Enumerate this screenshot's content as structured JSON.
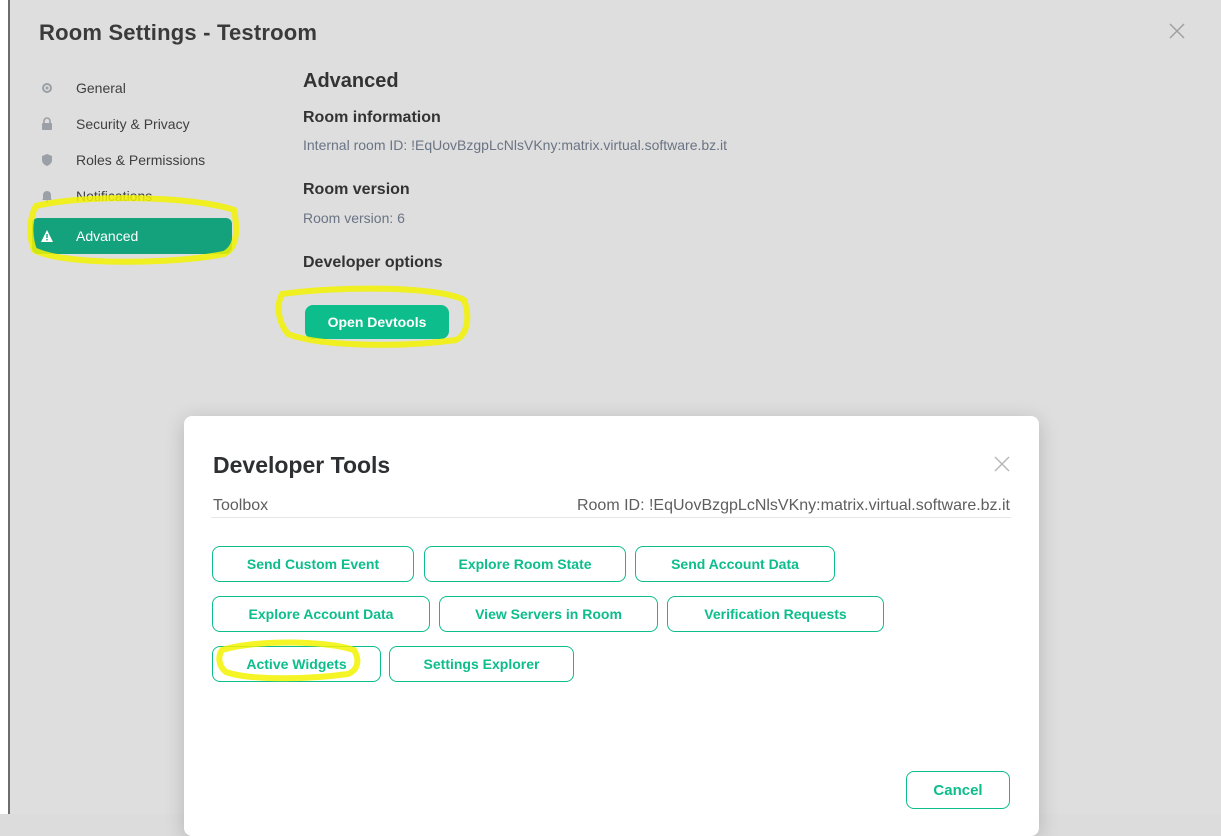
{
  "settings": {
    "title": "Room Settings - Testroom",
    "close_icon": "close-icon",
    "nav": [
      {
        "label": "General",
        "icon": "gear-icon"
      },
      {
        "label": "Security & Privacy",
        "icon": "lock-icon"
      },
      {
        "label": "Roles & Permissions",
        "icon": "shield-icon"
      },
      {
        "label": "Notifications",
        "icon": "bell-icon"
      },
      {
        "label": "Advanced",
        "icon": "warning-icon",
        "active": true
      }
    ]
  },
  "advanced": {
    "heading": "Advanced",
    "room_info_heading": "Room information",
    "internal_id": "Internal room ID: !EqUovBzgpLcNlsVKny:matrix.virtual.software.bz.it",
    "room_version_heading": "Room version",
    "room_version": "Room version: 6",
    "dev_options_heading": "Developer options",
    "open_devtools": "Open Devtools"
  },
  "devtools": {
    "title": "Developer Tools",
    "toolbox": "Toolbox",
    "room_id": "Room ID: !EqUovBzgpLcNlsVKny:matrix.virtual.software.bz.it",
    "buttons": [
      "Send Custom Event",
      "Explore Room State",
      "Send Account Data",
      "Explore Account Data",
      "View Servers in Room",
      "Verification Requests",
      "Active Widgets",
      "Settings Explorer"
    ],
    "cancel": "Cancel"
  },
  "colors": {
    "accent": "#0dbd8b",
    "active_nav": "#14a27d",
    "annotation_highlight": "#f5f500"
  }
}
